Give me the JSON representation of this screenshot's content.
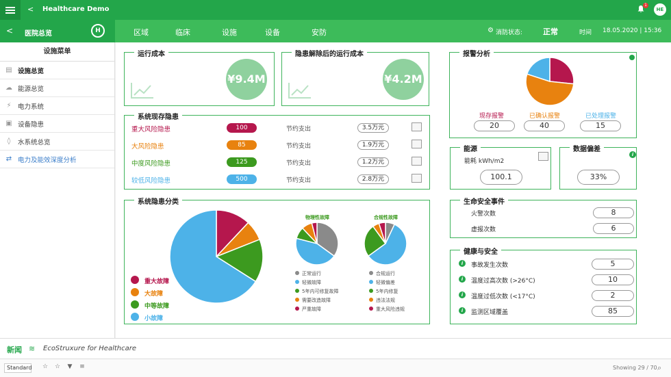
{
  "topbar": {
    "back": "<",
    "title": "Healthcare Demo",
    "notif_count": "1",
    "avatar": "HE"
  },
  "navbar": {
    "section_title": "医院总览",
    "logo": "H",
    "tabs": [
      "区域",
      "临床",
      "设施",
      "设备",
      "安防"
    ],
    "fire_label": "消防状态:",
    "fire_value": "正常",
    "time_label": "时间",
    "time_value": "18.05.2020 | 15:36"
  },
  "sidebar": {
    "header": "设施菜单",
    "items": [
      {
        "label": "设施总览",
        "icon": "document-icon"
      },
      {
        "label": "能源总览",
        "icon": "cloud-icon"
      },
      {
        "label": "电力系统",
        "icon": "plug-icon"
      },
      {
        "label": "设备隐患",
        "icon": "device-icon"
      },
      {
        "label": "水系统总览",
        "icon": "water-drop-icon"
      },
      {
        "label": "电力及能效深度分析",
        "icon": "analysis-icon"
      }
    ]
  },
  "cost": {
    "title": "运行成本",
    "value": "¥9.4M"
  },
  "cost_after": {
    "title": "隐患解除后的运行成本",
    "value": "¥4.2M"
  },
  "hazards": {
    "title": "系统现存隐患",
    "save_label": "节约支出",
    "rows": [
      {
        "name": "重大风险隐患",
        "count": "100",
        "color": "#b5174d",
        "saving": "3.5万元"
      },
      {
        "name": "大风险隐患",
        "count": "85",
        "color": "#e8820f",
        "saving": "1.9万元"
      },
      {
        "name": "中度风险隐患",
        "count": "125",
        "color": "#3c9a1f",
        "saving": "1.2万元"
      },
      {
        "name": "较低风险隐患",
        "count": "500",
        "color": "#4db2e8",
        "saving": "2.8万元"
      }
    ]
  },
  "classification": {
    "title": "系统隐患分类",
    "legend": [
      "重大故障",
      "大故障",
      "中等故障",
      "小故障"
    ],
    "legend_colors": [
      "#b5174d",
      "#e8820f",
      "#3c9a1f",
      "#4db2e8"
    ],
    "mini1_title": "物理性故障",
    "mini1_legend": [
      "正常运行",
      "轻微故障",
      "5年内可修复故障",
      "需要改造故障",
      "严重故障"
    ],
    "mini2_title": "合规性故障",
    "mini2_legend": [
      "合规运行",
      "轻微偏差",
      "5年内修复",
      "违法法规",
      "重大风险违规"
    ]
  },
  "chart_data": [
    {
      "type": "pie",
      "categories": [
        "重大故障",
        "大故障",
        "中等故障",
        "小故障"
      ],
      "values": [
        12,
        7,
        15,
        66
      ]
    },
    {
      "type": "pie",
      "title": "物理性故障",
      "categories": [
        "正常运行",
        "轻微故障",
        "5年内可修复故障",
        "需要改造故障",
        "严重故障"
      ],
      "values": [
        35,
        44,
        9,
        8,
        4
      ]
    },
    {
      "type": "pie",
      "title": "合规性故障",
      "categories": [
        "合规运行",
        "轻微偏差",
        "5年内修复",
        "违法法规",
        "重大风险违规"
      ],
      "values": [
        7,
        58,
        25,
        5,
        5
      ]
    },
    {
      "type": "pie",
      "title": "报警分析",
      "categories": [
        "现存报警",
        "已确认报警",
        "已处理报警"
      ],
      "values": [
        20,
        40,
        15
      ]
    }
  ],
  "alarm": {
    "title": "报警分析",
    "labels": [
      "现存报警",
      "已确认报警",
      "已处理报警"
    ],
    "values": [
      "20",
      "40",
      "15"
    ],
    "colors": [
      "#b5174d",
      "#e8820f",
      "#4db2e8"
    ]
  },
  "energy": {
    "title": "能源",
    "label": "能耗 kWh/m2",
    "value": "100.1"
  },
  "data_dev": {
    "title": "数据偏差",
    "value": "33%"
  },
  "safety": {
    "title": "生命安全事件",
    "rows": [
      {
        "label": "火警次数",
        "value": "8"
      },
      {
        "label": "虚报次数",
        "value": "6"
      }
    ]
  },
  "health": {
    "title": "健康与安全",
    "rows": [
      {
        "label": "事故发生次数",
        "value": "5"
      },
      {
        "label": "温度过高次数 (>26°C)",
        "value": "10"
      },
      {
        "label": "温度过低次数 (<17°C)",
        "value": "2"
      },
      {
        "label": "监测区域覆盖",
        "value": "85"
      }
    ]
  },
  "footer": {
    "news": "新闻",
    "brand": "EcoStruxure for Healthcare"
  },
  "toolbar": {
    "view": "Standard",
    "showing": "Showing 29 / 70"
  }
}
